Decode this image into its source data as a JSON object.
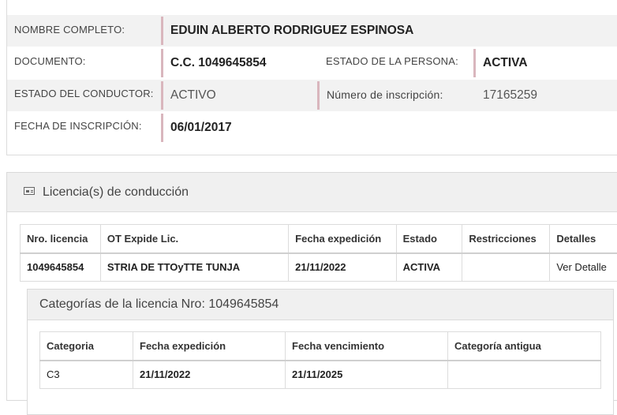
{
  "person": {
    "name_label": "NOMBRE COMPLETO:",
    "name_value": "EDUIN ALBERTO RODRIGUEZ ESPINOSA",
    "doc_label": "DOCUMENTO:",
    "doc_value": "C.C. 1049645854",
    "person_state_label": "ESTADO DE LA PERSONA:",
    "person_state_value": "ACTIVA",
    "driver_state_label": "ESTADO DEL CONDUCTOR:",
    "driver_state_value": "ACTIVO",
    "inscription_number_label": "Número de inscripción:",
    "inscription_number_value": "17165259",
    "inscription_date_label": "FECHA DE INSCRIPCIÓN:",
    "inscription_date_value": "06/01/2017"
  },
  "licenses": {
    "icon": "id-card-icon",
    "title": "Licencia(s) de conducción",
    "headers": [
      "Nro. licencia",
      "OT Expide Lic.",
      "Fecha expedición",
      "Estado",
      "Restricciones",
      "Detalles"
    ],
    "rows": [
      {
        "number": "1049645854",
        "issuer": "STRIA DE TTOyTTE TUNJA",
        "issue_date": "21/11/2022",
        "status": "ACTIVA",
        "restrictions": "",
        "details_link": "Ver Detalle"
      }
    ]
  },
  "categories": {
    "title": "Categorías de la licencia Nro: 1049645854",
    "headers": [
      "Categoria",
      "Fecha expedición",
      "Fecha vencimiento",
      "Categoría antigua"
    ],
    "rows": [
      {
        "category": "C3",
        "issue_date": "21/11/2022",
        "expiry_date": "21/11/2025",
        "old_category": ""
      }
    ]
  }
}
